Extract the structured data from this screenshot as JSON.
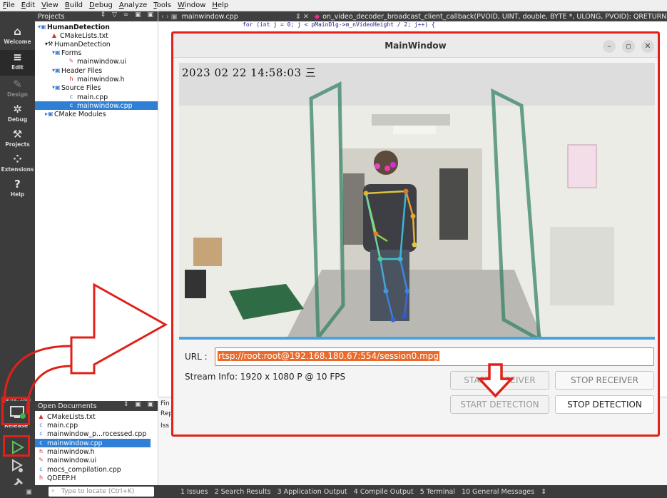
{
  "menu": [
    "File",
    "Edit",
    "View",
    "Build",
    "Debug",
    "Analyze",
    "Tools",
    "Window",
    "Help"
  ],
  "modes": [
    {
      "label": "Welcome",
      "icon": "home-icon"
    },
    {
      "label": "Edit",
      "icon": "edit-icon"
    },
    {
      "label": "Design",
      "icon": "design-icon"
    },
    {
      "label": "Debug",
      "icon": "debug-icon"
    },
    {
      "label": "Projects",
      "icon": "wrench-icon"
    },
    {
      "label": "Extensions",
      "icon": "extensions-icon"
    },
    {
      "label": "Help",
      "icon": "help-icon"
    }
  ],
  "kit": {
    "project": "Huma...tion",
    "config": "Release"
  },
  "projects_panel": {
    "title": "Projects",
    "tree": [
      {
        "label": "HumanDetection",
        "icon": "folder-icon"
      },
      {
        "label": "CMakeLists.txt",
        "icon": "cmake-icon"
      },
      {
        "label": "HumanDetection",
        "icon": "hammer-icon"
      },
      {
        "label": "Forms",
        "icon": "folder-icon"
      },
      {
        "label": "mainwindow.ui",
        "icon": "ui-file-icon"
      },
      {
        "label": "Header Files",
        "icon": "folder-icon"
      },
      {
        "label": "mainwindow.h",
        "icon": "header-file-icon"
      },
      {
        "label": "Source Files",
        "icon": "folder-icon"
      },
      {
        "label": "main.cpp",
        "icon": "cpp-file-icon"
      },
      {
        "label": "mainwindow.cpp",
        "icon": "cpp-file-icon"
      },
      {
        "label": "CMake Modules",
        "icon": "folder-icon"
      }
    ]
  },
  "editor": {
    "file": "mainwindow.cpp",
    "function": "on_video_decoder_broadcast_client_callback(PVOID, UINT, double, BYTE *, ULONG, PVOID): QRETURN",
    "code_line": "for (int j = 0; j < pMainDlg->m_nVideoHeight / 2; j++) {"
  },
  "open_documents": {
    "title": "Open Documents",
    "files": [
      "CMakeLists.txt",
      "main.cpp",
      "mainwindow_p...rocessed.cpp",
      "mainwindow.cpp",
      "mainwindow.h",
      "mainwindow.ui",
      "mocs_compilation.cpp",
      "QDEEP.H"
    ]
  },
  "bottom_fragments": [
    "Fin",
    "Rep",
    "Iss"
  ],
  "status": {
    "locate_placeholder": "Type to locate (Ctrl+K)",
    "tabs": [
      "1 Issues",
      "2 Search Results",
      "3 Application Output",
      "4 Compile Output",
      "5 Terminal",
      "10 General Messages"
    ]
  },
  "main_window": {
    "title": "MainWindow",
    "timestamp": "2023 02 22 14:58:03 三",
    "url_label": "URL :",
    "url_value": "rtsp://root:root@192.168.180.67:554/session0.mpg",
    "stream_info": "Stream Info: 1920 x 1080 P  @ 10 FPS",
    "buttons": {
      "start_receiver": "START RECEIVER",
      "stop_receiver": "STOP RECEIVER",
      "start_detection": "START DETECTION",
      "stop_detection": "STOP DETECTION"
    }
  },
  "colors": {
    "highlight_red": "#e0211b",
    "selection_blue": "#2f7fd6",
    "url_selection": "#e86a2c"
  }
}
